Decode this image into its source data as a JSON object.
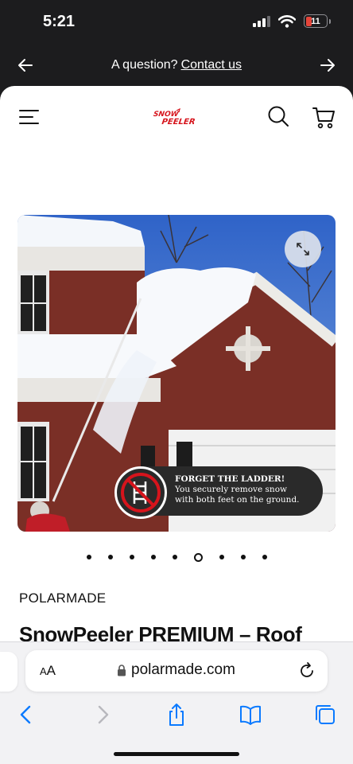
{
  "status_bar": {
    "time": "5:21",
    "battery_level": "11"
  },
  "announcement": {
    "text": "A question?",
    "link": "Contact us"
  },
  "header": {
    "logo_text_line1": "SNOW",
    "logo_text_line2": "PEELER"
  },
  "hero": {
    "callout_heading": "FORGET THE LADDER!",
    "callout_line1": "You securely remove snow",
    "callout_line2": "with both feet on the ground."
  },
  "carousel": {
    "dot_count": 9,
    "active_index": 5
  },
  "product": {
    "vendor": "POLARMADE",
    "title": "SnowPeeler PREMIUM – Roof"
  },
  "browser": {
    "text_size_label_small": "A",
    "text_size_label_large": "A",
    "url": "polarmade.com"
  },
  "colors": {
    "brand_red": "#d6141c",
    "accent_blue": "#0a7aff"
  }
}
